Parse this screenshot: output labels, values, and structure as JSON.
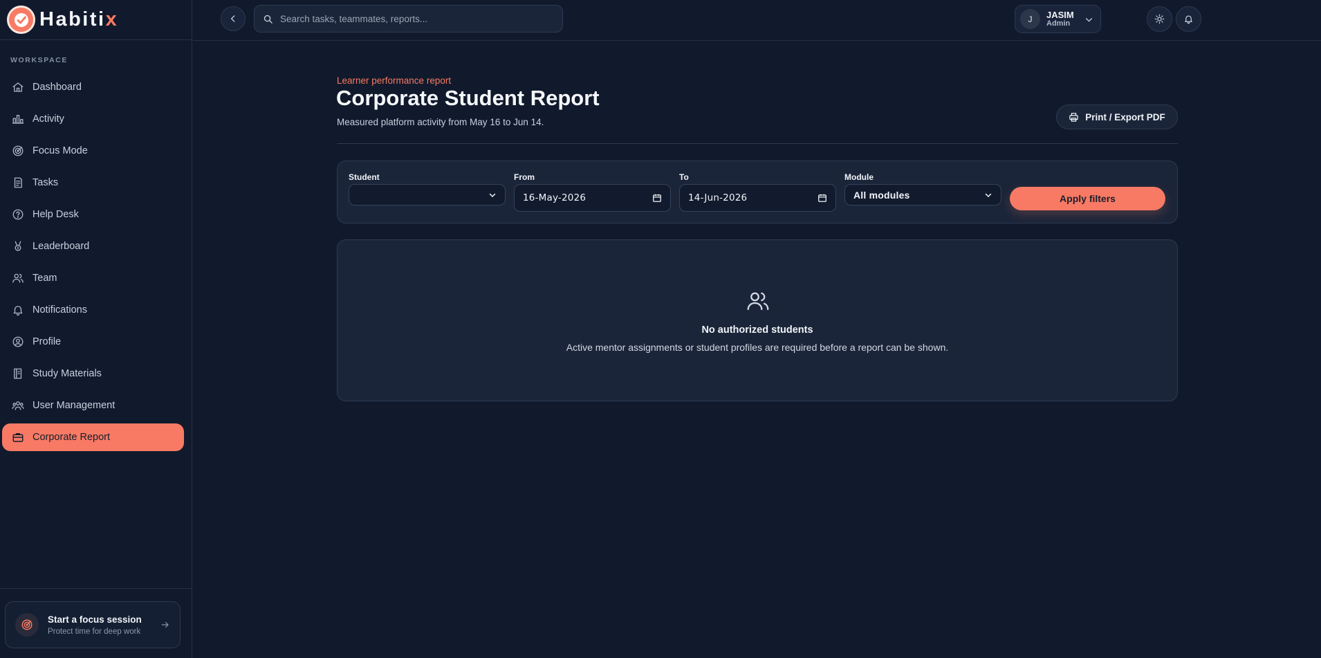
{
  "brand": {
    "name_main": "Habiti",
    "name_accent": "x"
  },
  "sidebar": {
    "section_label": "WORKSPACE",
    "items": [
      {
        "label": "Dashboard",
        "icon": "home-icon",
        "active": false
      },
      {
        "label": "Activity",
        "icon": "bar-chart-icon",
        "active": false
      },
      {
        "label": "Focus Mode",
        "icon": "target-icon",
        "active": false
      },
      {
        "label": "Tasks",
        "icon": "clipboard-icon",
        "active": false
      },
      {
        "label": "Help Desk",
        "icon": "help-circle-icon",
        "active": false
      },
      {
        "label": "Leaderboard",
        "icon": "medal-icon",
        "active": false
      },
      {
        "label": "Team",
        "icon": "users-icon",
        "active": false
      },
      {
        "label": "Notifications",
        "icon": "bell-icon",
        "active": false
      },
      {
        "label": "Profile",
        "icon": "user-circle-icon",
        "active": false
      },
      {
        "label": "Study Materials",
        "icon": "book-icon",
        "active": false
      },
      {
        "label": "User Management",
        "icon": "user-group-icon",
        "active": false
      },
      {
        "label": "Corporate Report",
        "icon": "briefcase-icon",
        "active": true
      }
    ],
    "focus_card": {
      "title": "Start a focus session",
      "subtitle": "Protect time for deep work"
    }
  },
  "topbar": {
    "search_placeholder": "Search tasks, teammates, reports...",
    "user": {
      "initial": "J",
      "name": "JASIM",
      "role": "Admin"
    }
  },
  "page": {
    "eyebrow": "Learner performance report",
    "title": "Corporate Student Report",
    "subtitle": "Measured platform activity from May 16 to Jun 14.",
    "export_label": "Print / Export PDF"
  },
  "filters": {
    "student_label": "Student",
    "student_value": "",
    "from_label": "From",
    "from_value": "16-May-2026",
    "to_label": "To",
    "to_value": "14-Jun-2026",
    "module_label": "Module",
    "module_value": "All modules",
    "apply_label": "Apply filters"
  },
  "empty_state": {
    "icon": "users-icon",
    "title": "No authorized students",
    "message": "Active mentor assignments or student profiles are required before a report can be shown."
  },
  "colors": {
    "accent": "#f87a64",
    "background": "#111a2c",
    "card": "#1b2539"
  }
}
